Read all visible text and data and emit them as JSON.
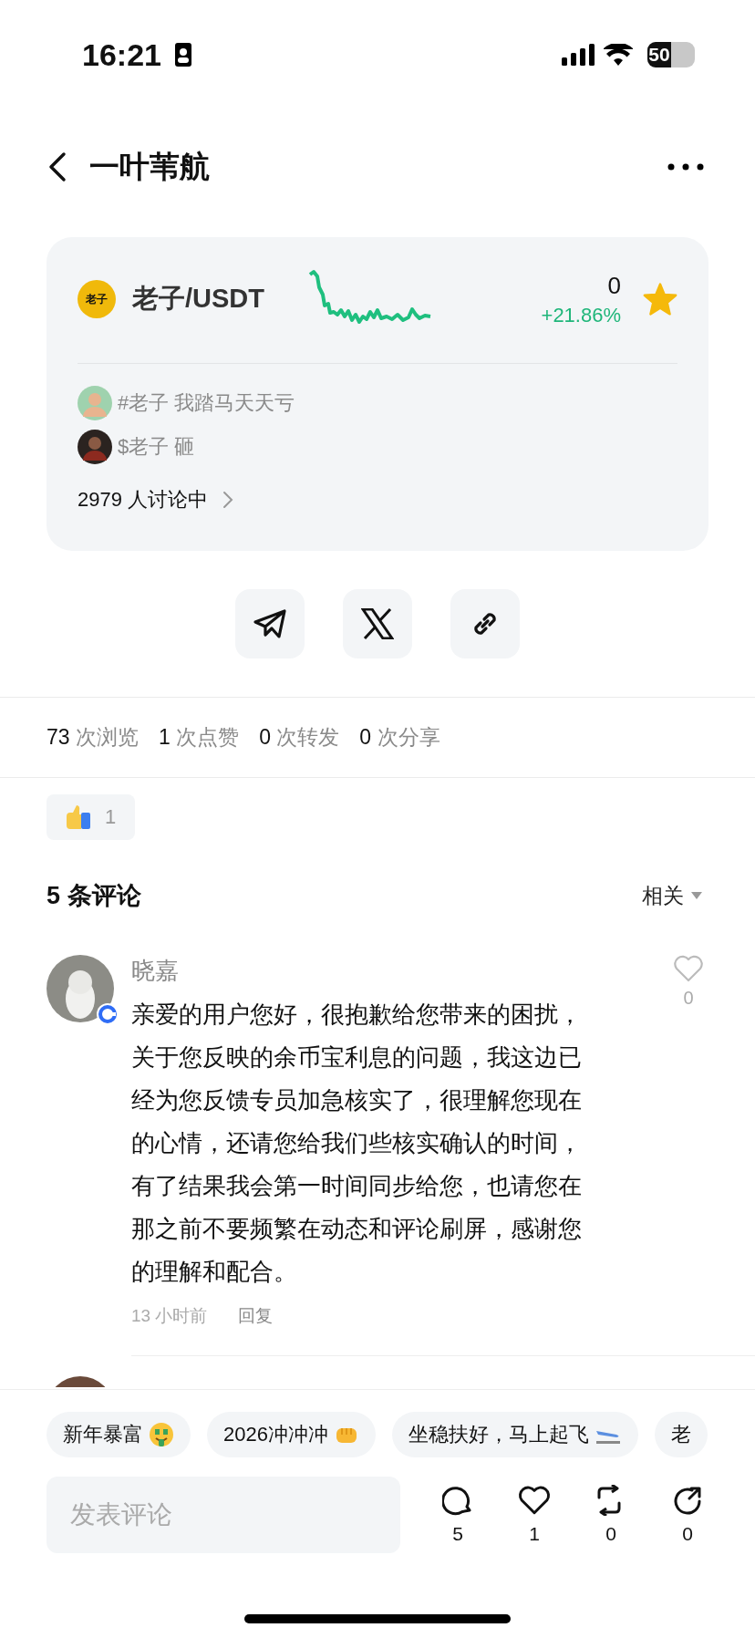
{
  "status_bar": {
    "time": "16:21",
    "battery": "50"
  },
  "header": {
    "title": "一叶苇航"
  },
  "coin_card": {
    "logo_text": "老子",
    "pair": "老子/USDT",
    "price": "0",
    "change": "+21.86%",
    "favorite": true,
    "topics": [
      {
        "text": "#老子 我踏马天天亏"
      },
      {
        "text": "$老子 砸"
      }
    ],
    "discussion": "2979 人讨论中"
  },
  "share_buttons": [
    {
      "kind": "telegram"
    },
    {
      "kind": "x"
    },
    {
      "kind": "link"
    }
  ],
  "stats": [
    {
      "count": "73",
      "label": "次浏览"
    },
    {
      "count": "1",
      "label": "次点赞"
    },
    {
      "count": "0",
      "label": "次转发"
    },
    {
      "count": "0",
      "label": "次分享"
    }
  ],
  "reaction": {
    "count": "1"
  },
  "comments_header": {
    "title": "5 条评论",
    "sort": "相关"
  },
  "comments": [
    {
      "name": "晓嘉",
      "verified": true,
      "body": "亲爱的用户您好，很抱歉给您带来的困扰，关于您反映的余币宝利息的问题，我这边已经为您反馈专员加急核实了，很理解您现在的心情，还请您给我们些核实确认的时间，有了结果我会第一时间同步给您，也请您在那之前不要频繁在动态和评论刷屏，感谢您的理解和配合。",
      "time": "13 小时前",
      "reply": "回复",
      "likes": "0",
      "liked": false
    }
  ],
  "quick_replies": [
    {
      "text": "新年暴富",
      "kind": "money"
    },
    {
      "text": "2026冲冲冲",
      "kind": "fist"
    },
    {
      "text": "坐稳扶好，马上起飞",
      "kind": "plane"
    },
    {
      "text": "老"
    }
  ],
  "composer": {
    "placeholder": "发表评论"
  },
  "actions": [
    {
      "kind": "comment",
      "count": "5"
    },
    {
      "kind": "like",
      "count": "1"
    },
    {
      "kind": "repost",
      "count": "0"
    },
    {
      "kind": "share",
      "count": "0"
    }
  ]
}
